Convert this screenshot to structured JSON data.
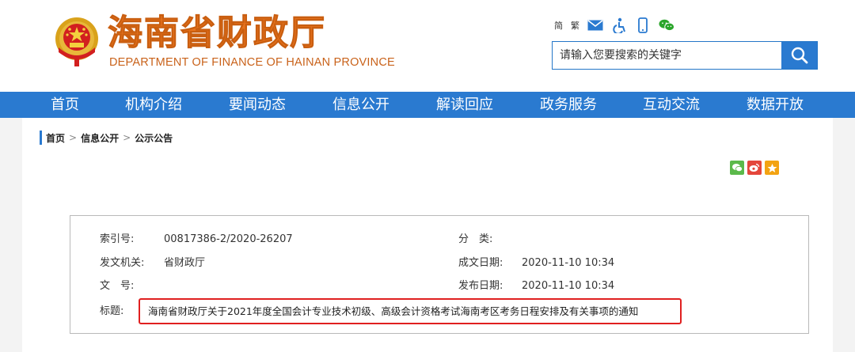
{
  "header": {
    "title": "海南省财政厅",
    "subtitle": "DEPARTMENT OF FINANCE OF HAINAN PROVINCE",
    "emblem_icon": "national-emblem-icon",
    "tools": {
      "simplified": "简",
      "traditional": "繁",
      "icons": [
        "mail-icon",
        "accessibility-icon",
        "mobile-icon",
        "wechat-icon"
      ]
    },
    "search": {
      "placeholder": "请输入您要搜索的关键字",
      "button_icon": "search-icon"
    },
    "colors": {
      "title": "#e8731d",
      "accent": "#2a7ad0"
    }
  },
  "nav": {
    "items": [
      "首页",
      "机构介绍",
      "要闻动态",
      "信息公开",
      "解读回应",
      "政务服务",
      "互动交流",
      "数据开放"
    ]
  },
  "breadcrumb": {
    "items": [
      "首页",
      "信息公开",
      "公示公告"
    ],
    "separator": ">"
  },
  "share": {
    "icons": [
      "wechat-share-icon",
      "weibo-share-icon",
      "favorite-star-icon"
    ]
  },
  "info": {
    "index_label": "索引号:",
    "index_value": "00817386-2/2020-26207",
    "category_label": "分　类:",
    "category_value": "",
    "issuer_label": "发文机关:",
    "issuer_value": "省财政厅",
    "created_label": "成文日期:",
    "created_value": "2020-11-10 10:34",
    "docno_label": "文　号:",
    "docno_value": "",
    "published_label": "发布日期:",
    "published_value": "2020-11-10 10:34",
    "title_label": "标题:",
    "title_value": "海南省财政厅关于2021年度全国会计专业技术初级、高级会计资格考试海南考区考务日程安排及有关事项的通知",
    "highlight_color": "#e02020"
  }
}
